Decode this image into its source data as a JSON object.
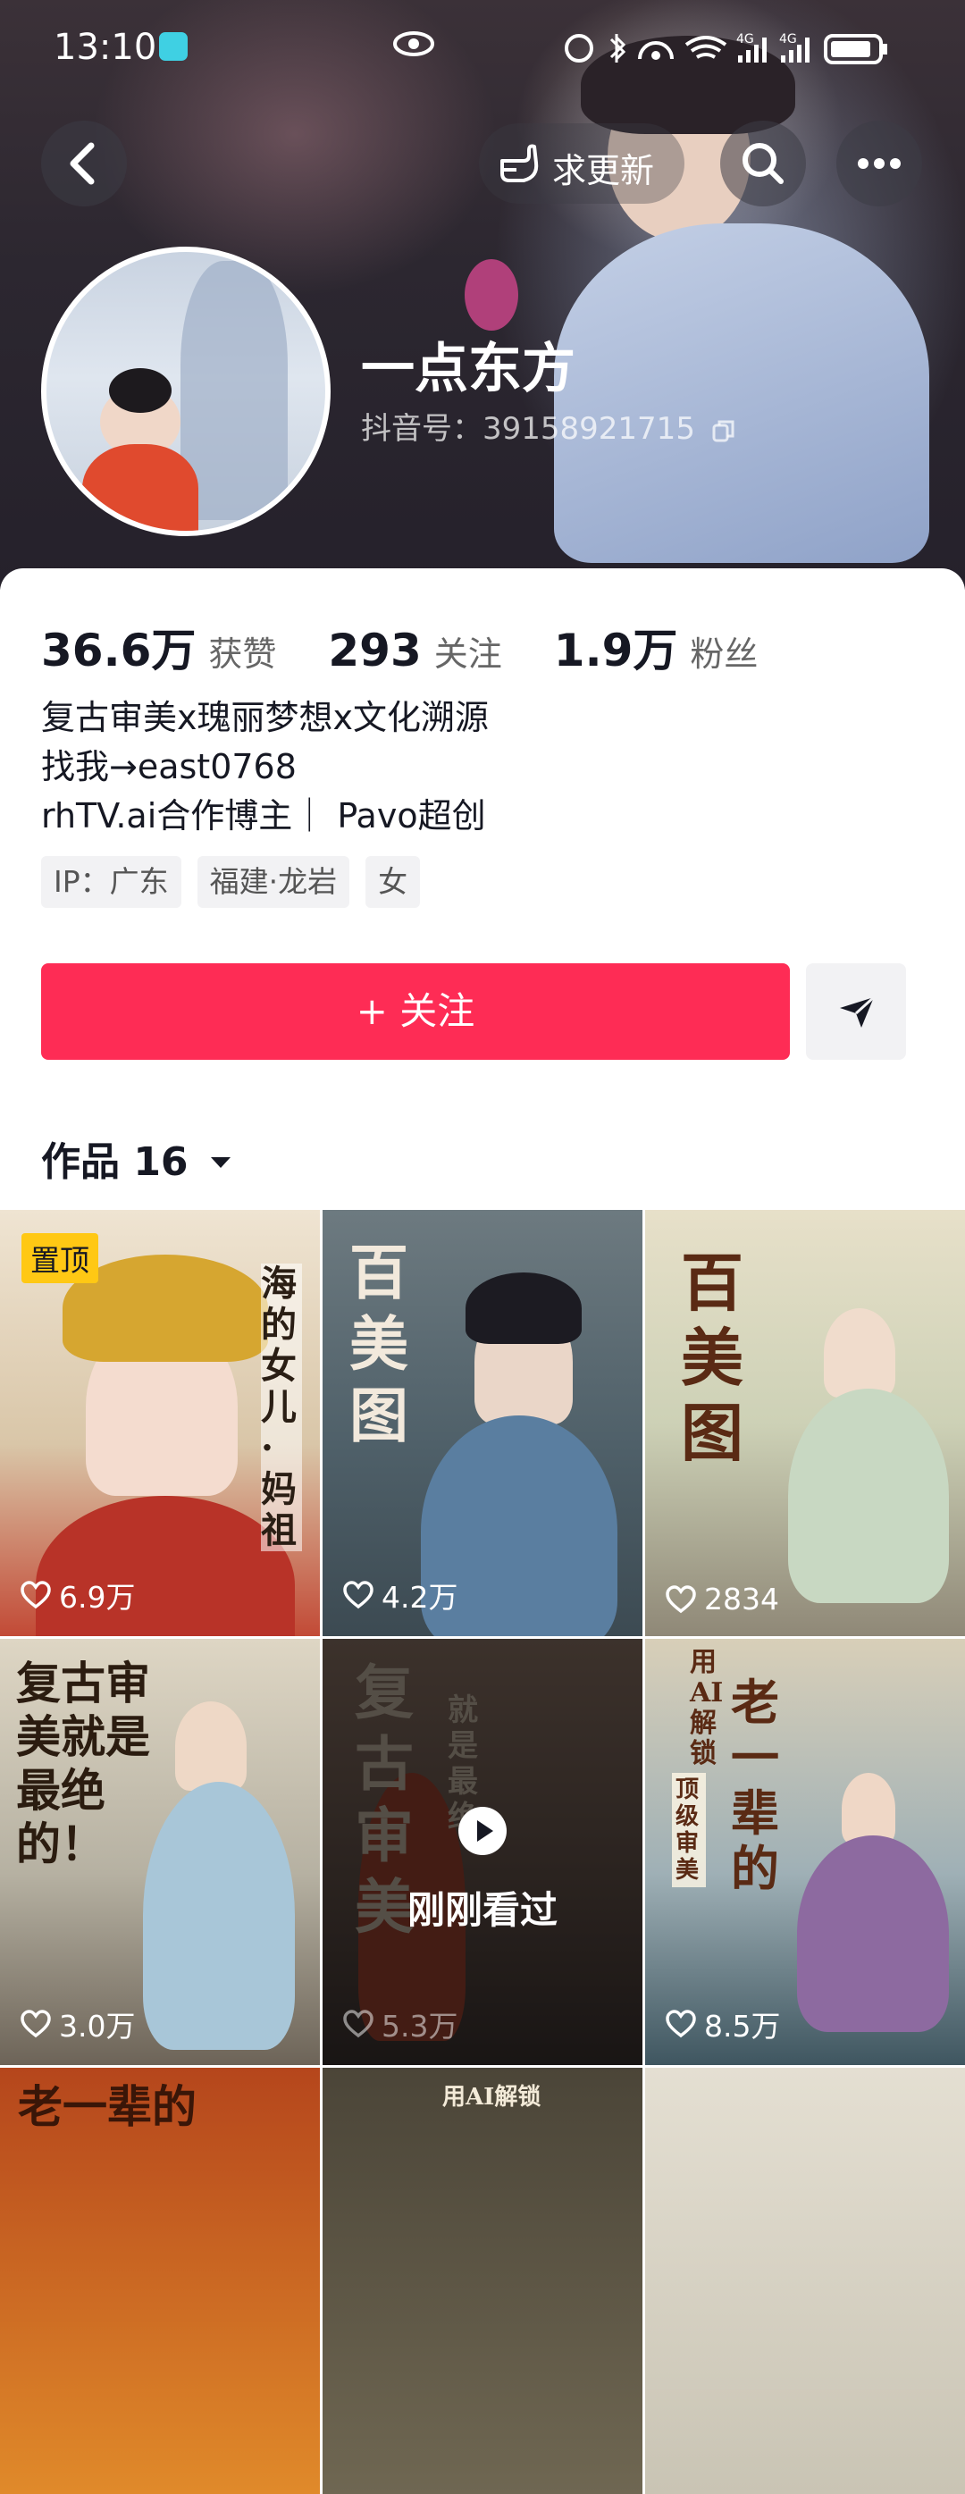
{
  "status_bar": {
    "time": "13:10",
    "network1": "4G",
    "network2": "4G"
  },
  "header": {
    "request_update_label": "求更新",
    "nickname": "一点东方",
    "douyin_id": "抖音号：39158921715"
  },
  "stats": [
    {
      "value": "36.6万",
      "label": "获赞"
    },
    {
      "value": "293",
      "label": "关注"
    },
    {
      "value": "1.9万",
      "label": "粉丝"
    }
  ],
  "bio": {
    "line1": "复古审美x瑰丽梦想x文化溯源",
    "line2": "找我→east0768",
    "line3": "rhTV.ai合作博主｜ Pavo超创"
  },
  "tags": [
    "IP：广东",
    "福建·龙岩",
    "女"
  ],
  "actions": {
    "follow_label": "+ 关注"
  },
  "works": {
    "label": "作品 16"
  },
  "videos": [
    {
      "likes": "6.9万",
      "pinned": "置顶",
      "title": "海的女儿·妈祖"
    },
    {
      "likes": "4.2万",
      "title": "百美图"
    },
    {
      "likes": "2834",
      "title": "百美图"
    },
    {
      "likes": "3.0万",
      "title": "复古审美就是最绝的！"
    },
    {
      "likes": "5.3万",
      "title": "复古审美",
      "subtitle": "就是最绝",
      "overlay": "刚刚看过"
    },
    {
      "likes": "8.5万",
      "title": "老一辈的",
      "subtitle": "用AI解锁",
      "badge": "顶级审美"
    },
    {
      "title": "老一辈的"
    },
    {
      "title": "用AI解锁"
    },
    {
      "title": ""
    }
  ],
  "colors": {
    "accent": "#fe2c55",
    "pin": "#ffc814"
  }
}
